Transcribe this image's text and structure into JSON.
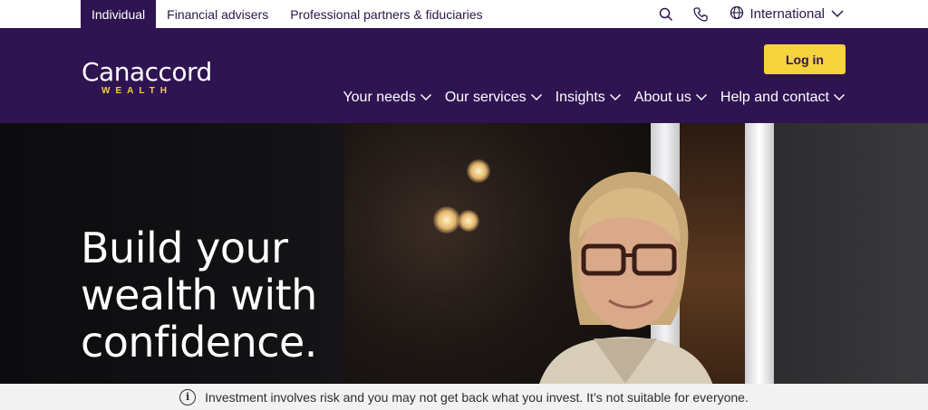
{
  "audience_tabs": [
    {
      "label": "Individual",
      "active": true
    },
    {
      "label": "Financial advisers",
      "active": false
    },
    {
      "label": "Professional partners & fiduciaries",
      "active": false
    }
  ],
  "utility": {
    "search_icon": "search-icon",
    "phone_icon": "phone-icon",
    "region_label": "International"
  },
  "brand": {
    "name": "Canaccord",
    "sub": "WEALTH"
  },
  "login_label": "Log in",
  "main_nav": [
    {
      "label": "Your needs"
    },
    {
      "label": "Our services"
    },
    {
      "label": "Insights"
    },
    {
      "label": "About us"
    },
    {
      "label": "Help and contact"
    }
  ],
  "hero": {
    "line1": "Build your",
    "line2": "wealth with",
    "line3": "confidence."
  },
  "risk_warning": "Investment involves risk and you may not get back what you invest. It’s not suitable for everyone.",
  "colors": {
    "brand_purple": "#2f1452",
    "accent_yellow": "#f5d33c"
  }
}
